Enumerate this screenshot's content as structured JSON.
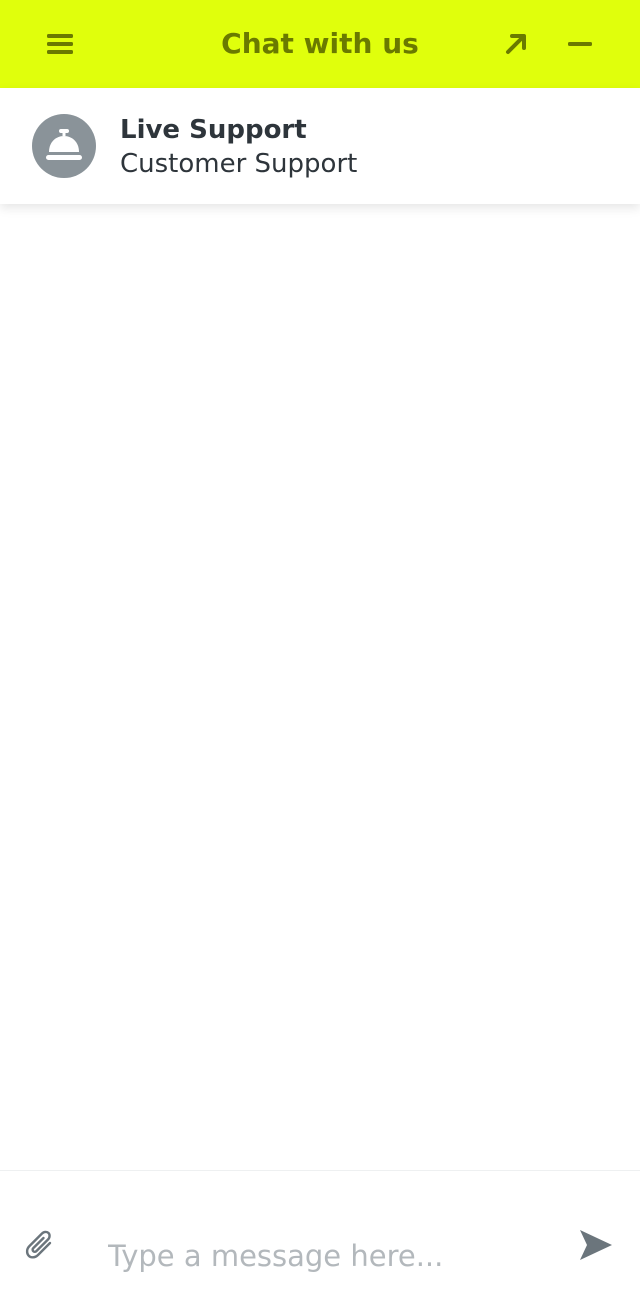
{
  "header": {
    "title": "Chat with us",
    "background_color": "#e0ff0c",
    "text_color": "#6a7a00",
    "menu_icon": "hamburger-menu-icon",
    "popout_icon": "arrow-up-right-icon",
    "minimize_icon": "minus-icon"
  },
  "agent": {
    "name": "Live Support",
    "role": "Customer Support",
    "avatar_icon": "service-bell-icon",
    "avatar_color": "#8a9399"
  },
  "composer": {
    "placeholder": "Type a message here...",
    "value": "",
    "attach_icon": "paperclip-icon",
    "send_icon": "send-arrow-icon"
  }
}
